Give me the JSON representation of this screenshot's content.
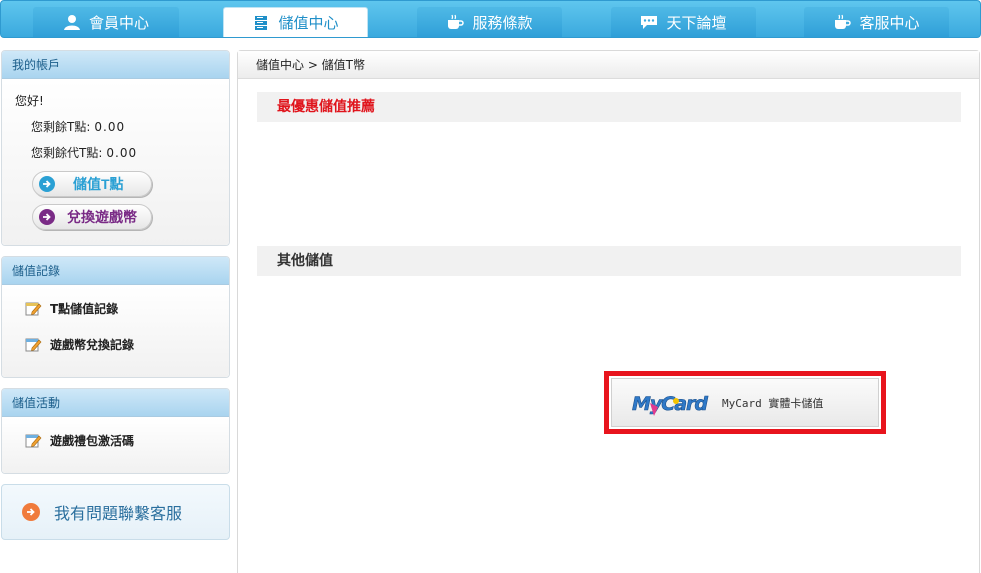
{
  "nav": {
    "tabs": [
      {
        "label": "會員中心",
        "icon": "user-icon",
        "active": false
      },
      {
        "label": "儲值中心",
        "icon": "server-icon",
        "active": true
      },
      {
        "label": "服務條款",
        "icon": "coffee-cup-icon",
        "active": false
      },
      {
        "label": "天下論壇",
        "icon": "chat-bubble-icon",
        "active": false
      },
      {
        "label": "客服中心",
        "icon": "coffee-cup-icon",
        "active": false
      }
    ]
  },
  "sidebar": {
    "account": {
      "title": "我的帳戶",
      "greeting": "您好!",
      "t_points_label": "您剩餘T點:",
      "t_points_value": "0.00",
      "proxy_points_label": "您剩餘代T點:",
      "proxy_points_value": "0.00",
      "topup_button": "儲值T點",
      "exchange_button": "兌換遊戲幣"
    },
    "records": {
      "title": "儲值記錄",
      "items": [
        "T點儲值記錄",
        "遊戲幣兌換記錄"
      ]
    },
    "events": {
      "title": "儲值活動",
      "items": [
        "遊戲禮包激活碼"
      ]
    },
    "help": {
      "label": "我有問題聯繫客服"
    }
  },
  "main": {
    "breadcrumb": "儲值中心 > 儲值T幣",
    "best_title": "最優惠儲值推薦",
    "other_title": "其他儲值",
    "mycard": {
      "logo_text": "MyCard",
      "label": "MyCard 實體卡儲值"
    }
  },
  "colors": {
    "nav_blue": "#3aa9de",
    "highlight_red": "#e8141d",
    "best_title_red": "#e0141c",
    "topup_circle": "#2aa0d4",
    "exchange_circle": "#7a2b86",
    "help_circle": "#f07b3c"
  }
}
